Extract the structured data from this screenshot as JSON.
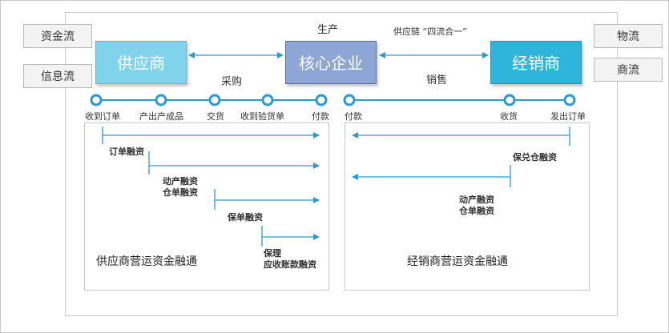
{
  "colors": {
    "supplier": "#7fd3ea",
    "core": "#8ea6d6",
    "distributor": "#2fb5dc",
    "arrow": "#2a9ad3",
    "node": "#2a9ad3"
  },
  "flows": {
    "capital": "资金流",
    "information": "信息流",
    "logistics": "物流",
    "commerce": "商流"
  },
  "entities": {
    "supplier": "供应商",
    "core": "核心企业",
    "distributor": "经销商"
  },
  "links": {
    "production": "生产",
    "procurement": "采购",
    "supply_chain": "供应链 “四流合一”",
    "sales": "销售"
  },
  "timeline": {
    "left_nodes": [
      "收到订单",
      "产出产成品",
      "交货",
      "收到验货单",
      "付款"
    ],
    "right_nodes": [
      "付款",
      "收货",
      "发出订单"
    ]
  },
  "left_panel": {
    "title": "供应商营运资金融通",
    "products": {
      "order_financing": "订单融资",
      "movable_financing": "动产融资",
      "warehouse_receipt_financing": "仓单融资",
      "factoring_financing": "保单融资",
      "factoring": "保理",
      "receivables_financing": "应收账款融资"
    }
  },
  "right_panel": {
    "title": "经销商营运资金融通",
    "products": {
      "guaranteed_warehouse_financing": "保兑仓融资",
      "movable_financing": "动产融资",
      "warehouse_receipt_financing": "仓单融资"
    }
  }
}
